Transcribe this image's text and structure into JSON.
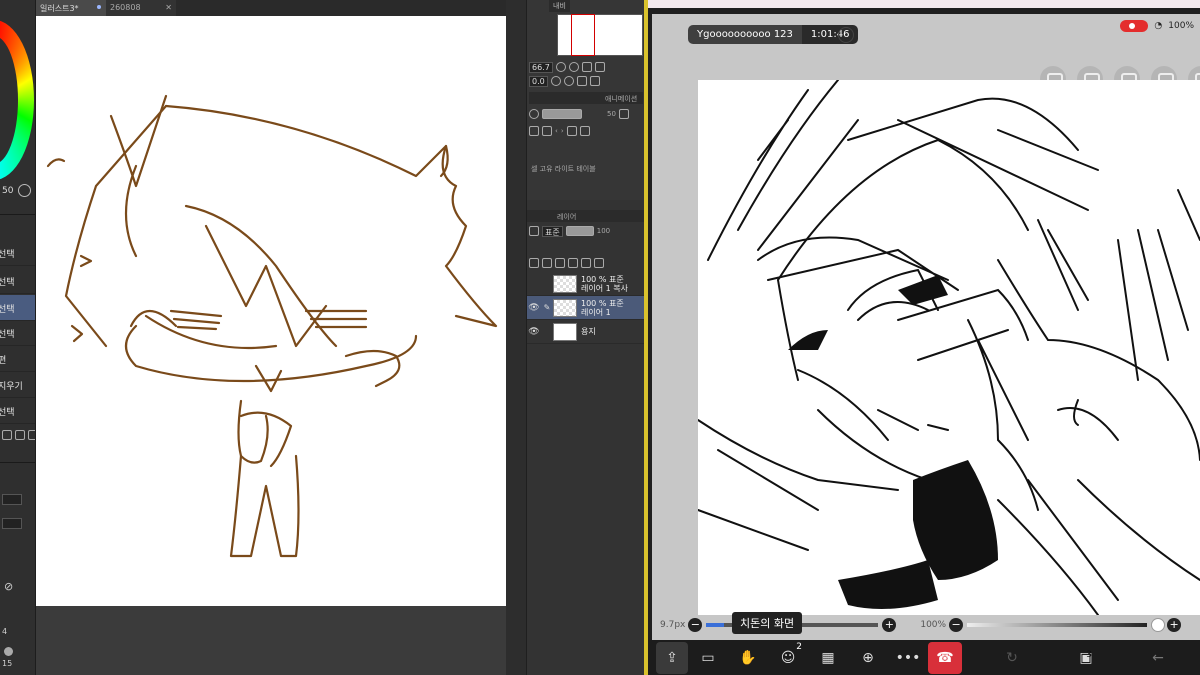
{
  "csp": {
    "tabs": [
      {
        "label": "일러스트3*",
        "state": "active"
      },
      {
        "label": "260808",
        "state": "inactive"
      }
    ],
    "rail": {
      "brush_size": "50",
      "items": [
        "선택",
        "선택",
        "선택",
        "선택",
        "편",
        "지우기",
        "선택"
      ]
    },
    "navigator": {
      "tab_label": "내비",
      "zoom": "66.7",
      "rotation": "0.0",
      "anim_tab": "애니메이션",
      "opacity_value": "50",
      "subtool_label": "셀 고유 라이트 테이블"
    },
    "layers": {
      "tab_label": "레이어",
      "blend_mode": "표준",
      "opacity": "100",
      "rows": [
        {
          "top": "100 % 표준",
          "name": "레이어 1 복사",
          "selected": false,
          "thumb": "checker"
        },
        {
          "top": "100 % 표준",
          "name": "레이어 1",
          "selected": true,
          "thumb": "checker"
        },
        {
          "top": "",
          "name": "용지",
          "selected": false,
          "thumb": "white"
        }
      ]
    },
    "bottom_numbers": [
      "4",
      "15"
    ]
  },
  "share": {
    "presenter_name": "Ygoooooooooo 123",
    "timer": "1:01:46",
    "battery": "100%",
    "brush_size_label": "9.7px",
    "zoom_label": "100%",
    "caption": "치돈의 화면",
    "participants_badge": "2",
    "pages_badge": "3",
    "colors": {
      "record": "#e42d2d",
      "end_call": "#d8303a",
      "accent_divider": "#d9c22d"
    }
  }
}
